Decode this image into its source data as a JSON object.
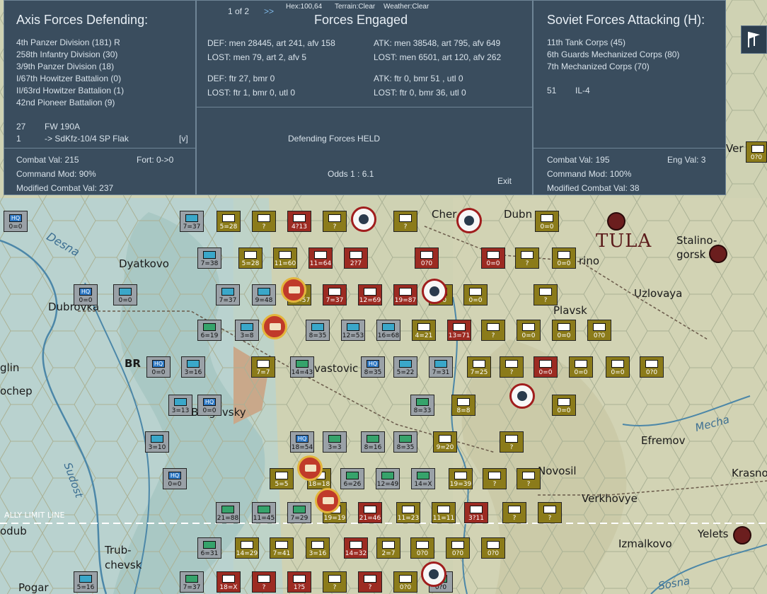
{
  "left_panel": {
    "title": "Axis Forces Defending:",
    "units": [
      "4th Panzer Division (181) R",
      "258th Infantry Division (30)",
      "3/9th Panzer Division (18)",
      "I/67th Howitzer Battalion (0)",
      "II/63rd Howitzer Battalion (1)",
      "42nd Pioneer Battalion (9)"
    ],
    "air_count": "27",
    "air_type": "FW 190A",
    "support_count": "1",
    "support_type": "-> SdKfz-10/4 SP Flak",
    "support_flag": "[v]",
    "combat_val": "Combat Val: 215",
    "fort": "Fort: 0->0",
    "command_mod": "Command Mod: 90%",
    "modified_val": "Modified Combat Val: 237"
  },
  "mid_panel": {
    "page": "1 of 2",
    "next": ">>",
    "hex": "Hex:100,64",
    "terrain": "Terrain:Clear",
    "weather": "Weather:Clear",
    "title": "Forces Engaged",
    "def_ground": "DEF: men 28445, art 241, afv 158",
    "def_lost": "LOST: men 79, art 2, afv 5",
    "atk_ground": "ATK: men 38548, art 795, afv 649",
    "atk_lost": "LOST: men 6501, art 120, afv 262",
    "def_air": "DEF: ftr 27, bmr 0",
    "def_air_lost": "LOST: ftr 1, bmr 0, utl 0",
    "atk_air": "ATK: ftr 0, bmr 51 , utl 0",
    "atk_air_lost": "LOST: ftr 0, bmr 36, utl 0",
    "result": "Defending Forces HELD",
    "odds": "Odds 1 : 6.1",
    "exit": "Exit"
  },
  "right_panel": {
    "title": "Soviet Forces Attacking (H):",
    "units": [
      "11th Tank Corps (45)",
      "6th Guards Mechanized Corps (80)",
      "7th Mechanized Corps (70)"
    ],
    "air_count": "51",
    "air_type": "IL-4",
    "combat_val": "Combat Val: 195",
    "eng_val": "Eng Val: 3",
    "command_mod": "Command Mod: 100%",
    "modified_val": "Modified Combat Val: 38"
  },
  "map_labels": {
    "dyatkovo": "Dyatkovo",
    "dubrovka": "Dubrovka",
    "desna": "Desna",
    "glin": "glin",
    "ochep": "ochep",
    "br": "BR",
    "vastovic": "vastovic",
    "egovsky": "B-Egovsky",
    "sudost": "Sudost",
    "ally_limit": "ALLY LIMIT LINE",
    "odub": "odub",
    "trubchevsk": "Trub-\nchevsk",
    "pogar": "Pogar",
    "cher": "Cher",
    "dubn": "Dubn",
    "tula": "TULA",
    "stalinogorsk": "Stalino-\ngorsk",
    "rino": "rino",
    "uzlovaya": "Uzlovaya",
    "plavsk": "Plavsk",
    "efremov": "Efremov",
    "mecha": "Mecha",
    "krasno": "Krasno",
    "novosil": "Novosil",
    "verkhovye": "Verkhovye",
    "yelets": "Yelets",
    "izmalkovo": "Izmalkovo",
    "sosna": "Sosna",
    "ver": "Ver"
  },
  "counters": [
    {
      "t": "hq",
      "v": "0=0"
    },
    {
      "t": "ger",
      "v": "7=37"
    },
    {
      "t": "sov",
      "v": "5=28"
    },
    {
      "t": "sov",
      "v": "?"
    },
    {
      "t": "red",
      "v": "4?13"
    },
    {
      "t": "sov",
      "v": "?"
    },
    {
      "t": "sov",
      "v": "?"
    },
    {
      "t": "sov",
      "v": "0=0"
    },
    {
      "t": "ger",
      "v": "7=38"
    },
    {
      "t": "sov",
      "v": "5=28"
    },
    {
      "t": "sov",
      "v": "11=60"
    },
    {
      "t": "red",
      "v": "11=64"
    },
    {
      "t": "red",
      "v": "2?7"
    },
    {
      "t": "red",
      "v": "0?0"
    },
    {
      "t": "red",
      "v": "0=0"
    },
    {
      "t": "sov",
      "v": "?"
    },
    {
      "t": "sov",
      "v": "0=0"
    },
    {
      "t": "hq",
      "v": "0=0"
    },
    {
      "t": "ger",
      "v": "0=0"
    },
    {
      "t": "ger",
      "v": "7=37"
    },
    {
      "t": "ger",
      "v": "9=48"
    },
    {
      "t": "sov",
      "v": "27=57"
    },
    {
      "t": "red",
      "v": "7=37"
    },
    {
      "t": "red",
      "v": "12=69"
    },
    {
      "t": "red",
      "v": "19=87"
    },
    {
      "t": "sov",
      "v": "0?0"
    },
    {
      "t": "sov",
      "v": "0=0"
    },
    {
      "t": "sov",
      "v": "?"
    },
    {
      "t": "gerg",
      "v": "6=19"
    },
    {
      "t": "ger",
      "v": "3=8"
    },
    {
      "t": "ger",
      "v": "8=35"
    },
    {
      "t": "ger",
      "v": "12=53"
    },
    {
      "t": "ger",
      "v": "16=68"
    },
    {
      "t": "sov",
      "v": "4=21"
    },
    {
      "t": "red",
      "v": "13=71"
    },
    {
      "t": "sov",
      "v": "?"
    },
    {
      "t": "sov",
      "v": "0=0"
    },
    {
      "t": "sov",
      "v": "0=0"
    },
    {
      "t": "sov",
      "v": "0?0"
    },
    {
      "t": "hq",
      "v": "0=0"
    },
    {
      "t": "ger",
      "v": "3=16"
    },
    {
      "t": "sov",
      "v": "7=7"
    },
    {
      "t": "gerg",
      "v": "14=43"
    },
    {
      "t": "hq",
      "v": "8=35"
    },
    {
      "t": "ger",
      "v": "5=22"
    },
    {
      "t": "ger",
      "v": "7=31"
    },
    {
      "t": "sov",
      "v": "7=25"
    },
    {
      "t": "sov",
      "v": "?"
    },
    {
      "t": "red",
      "v": "0=0"
    },
    {
      "t": "sov",
      "v": "0=0"
    },
    {
      "t": "sov",
      "v": "0=0"
    },
    {
      "t": "sov",
      "v": "0?0"
    },
    {
      "t": "ger",
      "v": "3=13"
    },
    {
      "t": "hq",
      "v": "0=0"
    },
    {
      "t": "gerg",
      "v": "8=33"
    },
    {
      "t": "sov",
      "v": "8=8"
    },
    {
      "t": "red",
      "v": "?"
    },
    {
      "t": "sov",
      "v": "0=0"
    },
    {
      "t": "ger",
      "v": "3=10"
    },
    {
      "t": "hq",
      "v": "18=54"
    },
    {
      "t": "gerg",
      "v": "3=3"
    },
    {
      "t": "gerg",
      "v": "8=16"
    },
    {
      "t": "gerg",
      "v": "8=35"
    },
    {
      "t": "sov",
      "v": "9=20"
    },
    {
      "t": "sov",
      "v": "?"
    },
    {
      "t": "hq",
      "v": "0=0"
    },
    {
      "t": "sov",
      "v": "5=5"
    },
    {
      "t": "sov",
      "v": "18=18"
    },
    {
      "t": "gerg",
      "v": "6=26"
    },
    {
      "t": "gerg",
      "v": "12=49"
    },
    {
      "t": "gerg",
      "v": "14=X"
    },
    {
      "t": "sov",
      "v": "19=39"
    },
    {
      "t": "sov",
      "v": "?"
    },
    {
      "t": "sov",
      "v": "?"
    },
    {
      "t": "gerg",
      "v": "21=88"
    },
    {
      "t": "gerg",
      "v": "11=45"
    },
    {
      "t": "gerg",
      "v": "7=29"
    },
    {
      "t": "sov",
      "v": "19=19"
    },
    {
      "t": "red",
      "v": "21=46"
    },
    {
      "t": "sov",
      "v": "11=23"
    },
    {
      "t": "sov",
      "v": "11=11"
    },
    {
      "t": "red",
      "v": "3?11"
    },
    {
      "t": "sov",
      "v": "?"
    },
    {
      "t": "sov",
      "v": "?"
    },
    {
      "t": "gerg",
      "v": "6=31"
    },
    {
      "t": "sov",
      "v": "14=29"
    },
    {
      "t": "sov",
      "v": "7=41"
    },
    {
      "t": "sov",
      "v": "3=16"
    },
    {
      "t": "red",
      "v": "14=32"
    },
    {
      "t": "sov",
      "v": "2=7"
    },
    {
      "t": "sov",
      "v": "0?0"
    },
    {
      "t": "sov",
      "v": "0?0"
    },
    {
      "t": "sov",
      "v": "0?0"
    },
    {
      "t": "ger",
      "v": "5=16"
    },
    {
      "t": "gerg",
      "v": "7=37"
    },
    {
      "t": "red",
      "v": "18=X"
    },
    {
      "t": "red",
      "v": "?"
    },
    {
      "t": "red",
      "v": "1?5"
    },
    {
      "t": "sov",
      "v": "?"
    },
    {
      "t": "red",
      "v": "?"
    },
    {
      "t": "sov",
      "v": "0?0"
    },
    {
      "t": "gerg",
      "v": "0?0"
    }
  ]
}
